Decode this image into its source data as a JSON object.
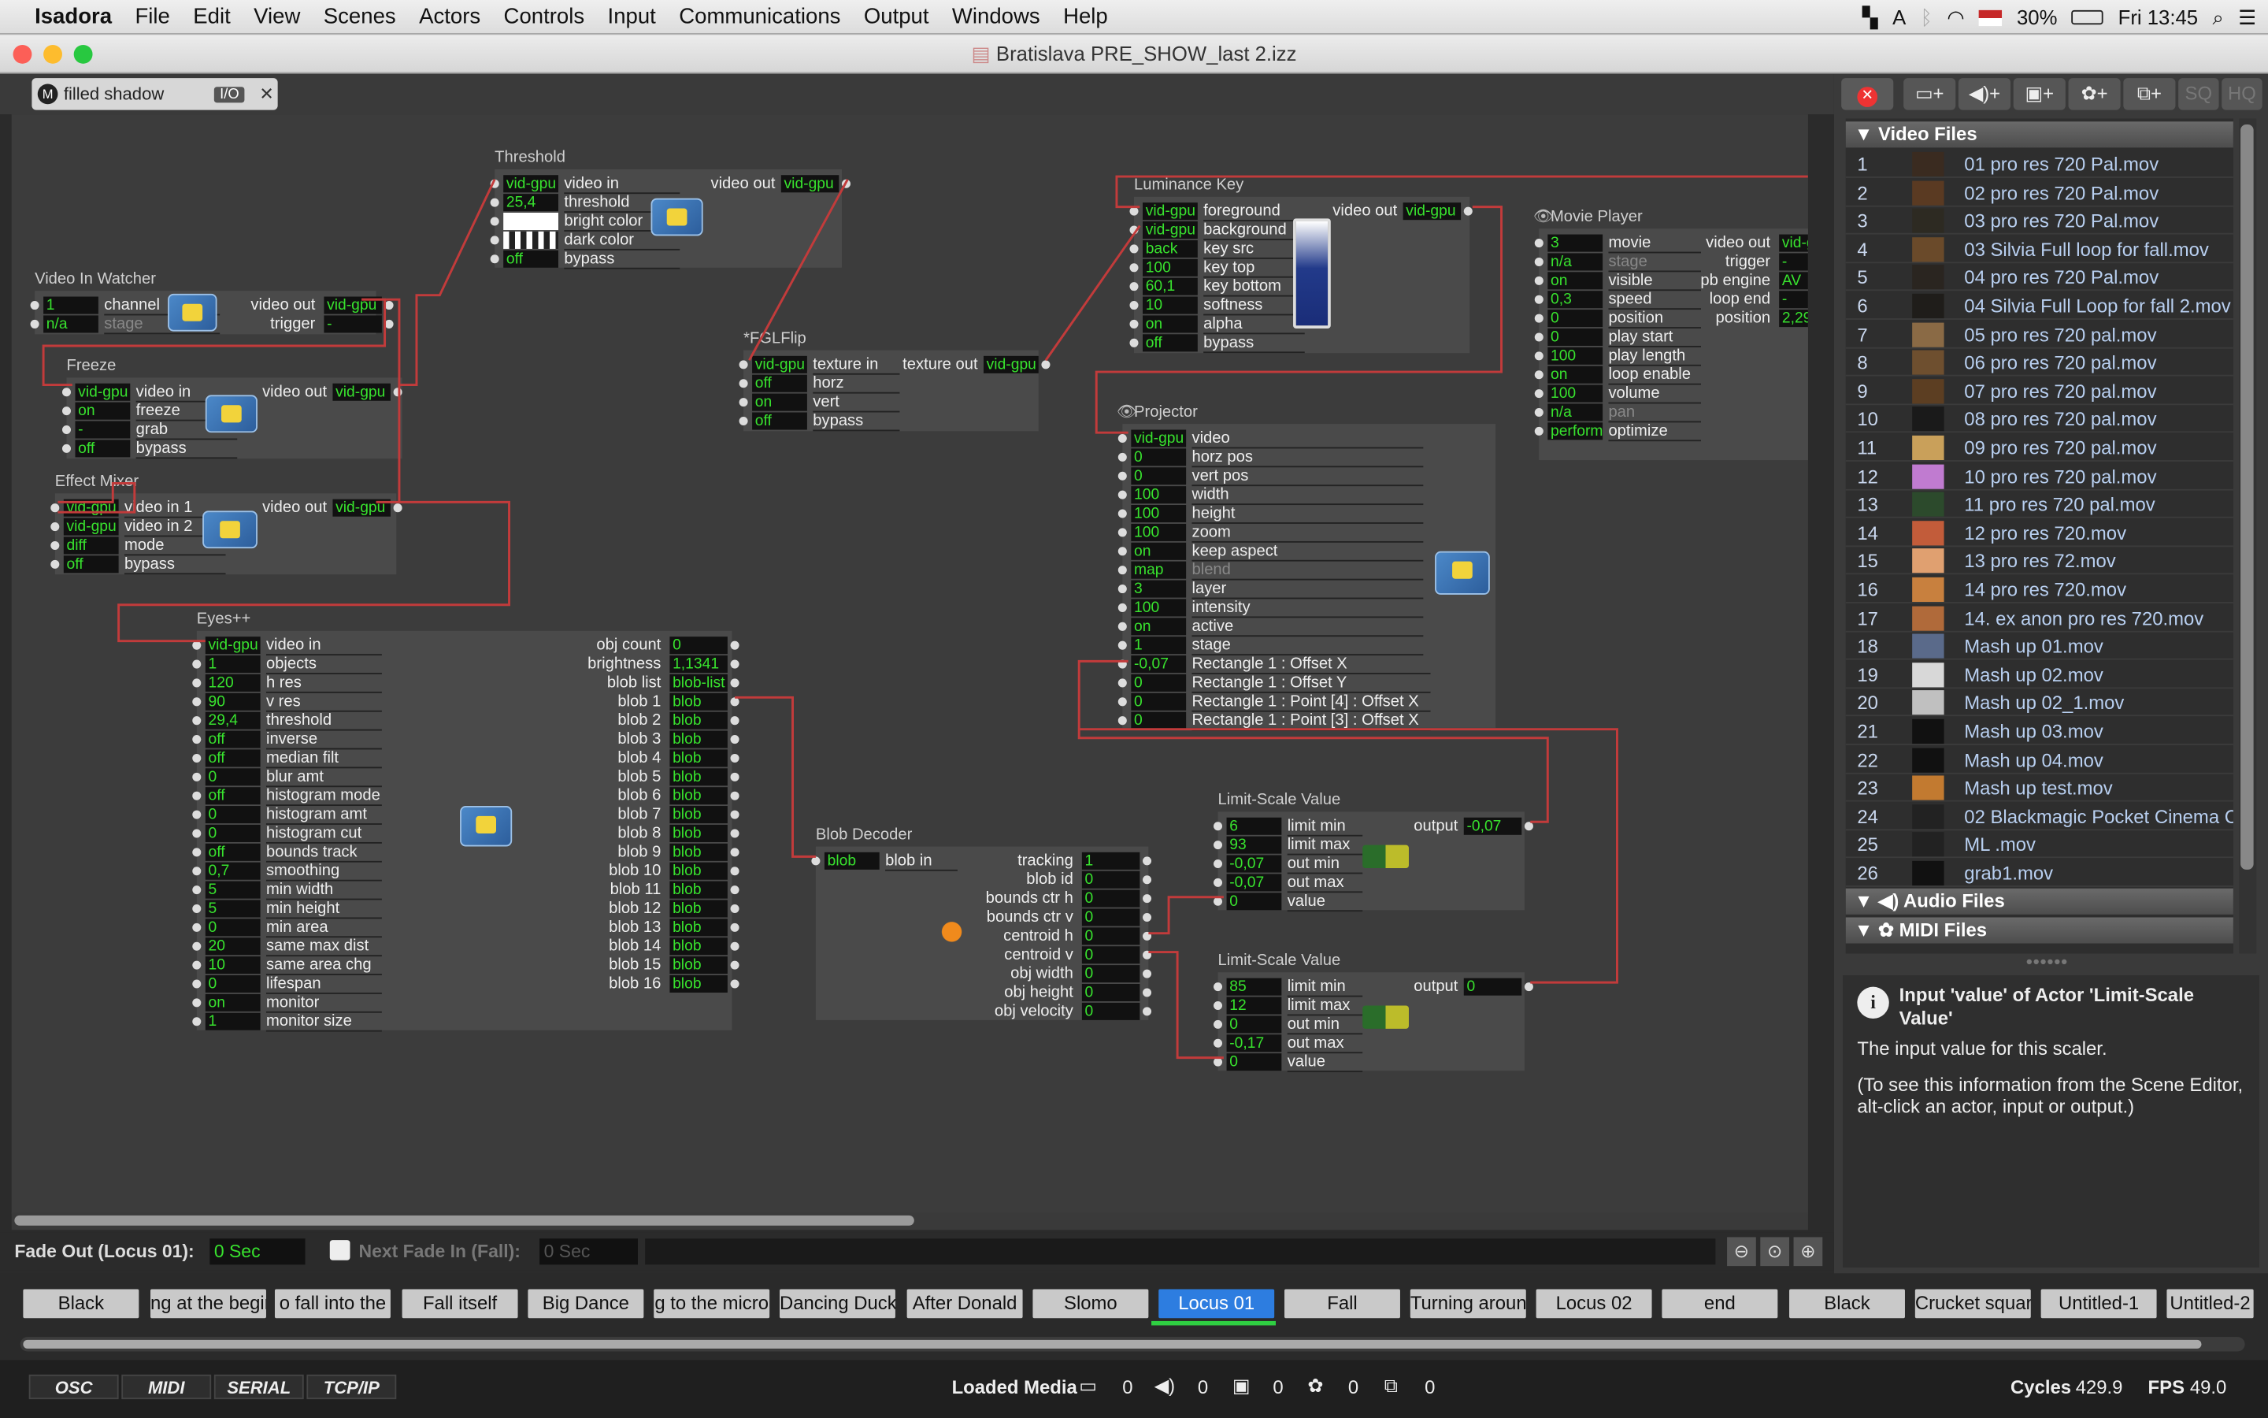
{
  "menubar": {
    "app": "Isadora",
    "items": [
      "File",
      "Edit",
      "View",
      "Scenes",
      "Actors",
      "Controls",
      "Input",
      "Communications",
      "Output",
      "Windows",
      "Help"
    ],
    "battery": "30%",
    "clock": "Fri 13:45"
  },
  "window": {
    "title": "Bratislava PRE_SHOW_last 2.izz"
  },
  "scene_tab": {
    "label": "filled shadow",
    "io": "I/O"
  },
  "actors": {
    "threshold": {
      "title": "Threshold",
      "inputs": [
        [
          "vid-gpu",
          "video in"
        ],
        [
          "25,4",
          "threshold"
        ],
        [
          "",
          "bright color"
        ],
        [
          "",
          "dark color"
        ],
        [
          "off",
          "bypass"
        ]
      ],
      "out_label": "video out",
      "out_value": "vid-gpu"
    },
    "video_in_watcher": {
      "title": "Video In Watcher",
      "inputs": [
        [
          "1",
          "channel"
        ],
        [
          "n/a",
          "stage"
        ]
      ],
      "outs": [
        [
          "video out",
          "vid-gpu"
        ],
        [
          "trigger",
          "-"
        ]
      ]
    },
    "freeze": {
      "title": "Freeze",
      "inputs": [
        [
          "vid-gpu",
          "video in"
        ],
        [
          "on",
          "freeze"
        ],
        [
          "-",
          "grab"
        ],
        [
          "off",
          "bypass"
        ]
      ],
      "out_label": "video out",
      "out_value": "vid-gpu"
    },
    "effect_mixer": {
      "title": "Effect Mixer",
      "inputs": [
        [
          "vid-gpu",
          "video in 1"
        ],
        [
          "vid-gpu",
          "video in 2"
        ],
        [
          "diff",
          "mode"
        ],
        [
          "off",
          "bypass"
        ]
      ],
      "out_label": "video out",
      "out_value": "vid-gpu"
    },
    "fglflip": {
      "title": "*FGLFlip",
      "inputs": [
        [
          "vid-gpu",
          "texture in"
        ],
        [
          "off",
          "horz"
        ],
        [
          "on",
          "vert"
        ],
        [
          "off",
          "bypass"
        ]
      ],
      "out_label": "texture out",
      "out_value": "vid-gpu"
    },
    "luminance_key": {
      "title": "Luminance Key",
      "inputs": [
        [
          "vid-gpu",
          "foreground"
        ],
        [
          "vid-gpu",
          "background"
        ],
        [
          "back",
          "key src"
        ],
        [
          "100",
          "key top"
        ],
        [
          "60,1",
          "key bottom"
        ],
        [
          "10",
          "softness"
        ],
        [
          "on",
          "alpha"
        ],
        [
          "off",
          "bypass"
        ]
      ],
      "out_label": "video out",
      "out_value": "vid-gpu"
    },
    "movie_player": {
      "title": "Movie Player",
      "inputs": [
        [
          "3",
          "movie"
        ],
        [
          "n/a",
          "stage"
        ],
        [
          "on",
          "visible"
        ],
        [
          "0,3",
          "speed"
        ],
        [
          "0",
          "position"
        ],
        [
          "0",
          "play start"
        ],
        [
          "100",
          "play length"
        ],
        [
          "on",
          "loop enable"
        ],
        [
          "100",
          "volume"
        ],
        [
          "n/a",
          "pan"
        ],
        [
          "performa",
          "optimize"
        ]
      ],
      "outs": [
        [
          "video out",
          "vid-g"
        ],
        [
          "trigger",
          "-"
        ],
        [
          "pb engine",
          "AV"
        ],
        [
          "loop end",
          "-"
        ],
        [
          "position",
          "2,29"
        ]
      ]
    },
    "projector": {
      "title": "Projector",
      "inputs": [
        [
          "vid-gpu",
          "video"
        ],
        [
          "0",
          "horz pos"
        ],
        [
          "0",
          "vert pos"
        ],
        [
          "100",
          "width"
        ],
        [
          "100",
          "height"
        ],
        [
          "100",
          "zoom"
        ],
        [
          "on",
          "keep aspect"
        ],
        [
          "map",
          "blend"
        ],
        [
          "3",
          "layer"
        ],
        [
          "100",
          "intensity"
        ],
        [
          "on",
          "active"
        ],
        [
          "1",
          "stage"
        ],
        [
          "-0,07",
          "Rectangle 1 : Offset X"
        ],
        [
          "0",
          "Rectangle 1 : Offset Y"
        ],
        [
          "0",
          "Rectangle 1 : Point [4] : Offset X"
        ],
        [
          "0",
          "Rectangle 1 : Point [3] : Offset X"
        ]
      ]
    },
    "eyes": {
      "title": "Eyes++",
      "inputs": [
        [
          "vid-gpu",
          "video in"
        ],
        [
          "1",
          "objects"
        ],
        [
          "120",
          "h res"
        ],
        [
          "90",
          "v res"
        ],
        [
          "29,4",
          "threshold"
        ],
        [
          "off",
          "inverse"
        ],
        [
          "off",
          "median filt"
        ],
        [
          "0",
          "blur amt"
        ],
        [
          "off",
          "histogram mode"
        ],
        [
          "0",
          "histogram amt"
        ],
        [
          "0",
          "histogram cut"
        ],
        [
          "off",
          "bounds track"
        ],
        [
          "0,7",
          "smoothing"
        ],
        [
          "5",
          "min width"
        ],
        [
          "5",
          "min height"
        ],
        [
          "0",
          "min area"
        ],
        [
          "20",
          "same max dist"
        ],
        [
          "10",
          "same area chg"
        ],
        [
          "0",
          "lifespan"
        ],
        [
          "on",
          "monitor"
        ],
        [
          "1",
          "monitor size"
        ]
      ],
      "outs": [
        [
          "obj count",
          "0"
        ],
        [
          "brightness",
          "1,1341"
        ],
        [
          "blob list",
          "blob-list"
        ],
        [
          "blob 1",
          "blob"
        ],
        [
          "blob 2",
          "blob"
        ],
        [
          "blob 3",
          "blob"
        ],
        [
          "blob 4",
          "blob"
        ],
        [
          "blob 5",
          "blob"
        ],
        [
          "blob 6",
          "blob"
        ],
        [
          "blob 7",
          "blob"
        ],
        [
          "blob 8",
          "blob"
        ],
        [
          "blob 9",
          "blob"
        ],
        [
          "blob 10",
          "blob"
        ],
        [
          "blob 11",
          "blob"
        ],
        [
          "blob 12",
          "blob"
        ],
        [
          "blob 13",
          "blob"
        ],
        [
          "blob 14",
          "blob"
        ],
        [
          "blob 15",
          "blob"
        ],
        [
          "blob 16",
          "blob"
        ]
      ]
    },
    "blob_decoder": {
      "title": "Blob Decoder",
      "inputs": [
        [
          "blob",
          "blob in"
        ]
      ],
      "outs": [
        [
          "tracking",
          "1"
        ],
        [
          "blob id",
          "0"
        ],
        [
          "bounds ctr h",
          "0"
        ],
        [
          "bounds ctr v",
          "0"
        ],
        [
          "centroid h",
          "0"
        ],
        [
          "centroid v",
          "0"
        ],
        [
          "obj width",
          "0"
        ],
        [
          "obj height",
          "0"
        ],
        [
          "obj velocity",
          "0"
        ]
      ]
    },
    "lsv1": {
      "title": "Limit-Scale Value",
      "inputs": [
        [
          "6",
          "limit min"
        ],
        [
          "93",
          "limit max"
        ],
        [
          "-0,07",
          "out min"
        ],
        [
          "-0,07",
          "out max"
        ],
        [
          "0",
          "value"
        ]
      ],
      "out_label": "output",
      "out_value": "-0,07"
    },
    "lsv2": {
      "title": "Limit-Scale Value",
      "inputs": [
        [
          "85",
          "limit min"
        ],
        [
          "12",
          "limit max"
        ],
        [
          "0",
          "out min"
        ],
        [
          "-0,17",
          "out max"
        ],
        [
          "0",
          "value"
        ]
      ],
      "out_label": "output",
      "out_value": "0"
    }
  },
  "fade": {
    "out_label": "Fade Out (Locus 01):",
    "out_value": "0 Sec",
    "next_label": "Next Fade In (Fall):",
    "next_value": "0 Sec"
  },
  "toolbar": {
    "sq": "SQ",
    "hq": "HQ"
  },
  "media": {
    "video_header": "Video Files",
    "videos": [
      [
        "1",
        "01 pro res 720 Pal.mov"
      ],
      [
        "2",
        "02 pro res 720 Pal.mov"
      ],
      [
        "3",
        "03 pro res 720 Pal.mov"
      ],
      [
        "4",
        "03 Silvia Full loop for fall.mov"
      ],
      [
        "5",
        "04 pro res 720 Pal.mov"
      ],
      [
        "6",
        "04 Silvia Full Loop for fall 2.mov"
      ],
      [
        "7",
        "05 pro res 720 pal.mov"
      ],
      [
        "8",
        "06 pro res 720 pal.mov"
      ],
      [
        "9",
        "07 pro res 720 pal.mov"
      ],
      [
        "10",
        "08 pro res 720 pal.mov"
      ],
      [
        "11",
        "09 pro res 720 pal.mov"
      ],
      [
        "12",
        "10 pro res 720 pal.mov"
      ],
      [
        "13",
        "11 pro res 720 pal.mov"
      ],
      [
        "14",
        "12 pro res 720.mov"
      ],
      [
        "15",
        "13 pro res 72.mov"
      ],
      [
        "16",
        "14 pro res 720.mov"
      ],
      [
        "17",
        "14. ex anon pro res 720.mov"
      ],
      [
        "18",
        "Mash up 01.mov"
      ],
      [
        "19",
        "Mash up 02.mov"
      ],
      [
        "20",
        "Mash up 02_1.mov"
      ],
      [
        "21",
        "Mash up 03.mov"
      ],
      [
        "22",
        "Mash up 04.mov"
      ],
      [
        "23",
        "Mash up test.mov"
      ],
      [
        "24",
        "02 Blackmagic Pocket Cinema C"
      ],
      [
        "25",
        "ML .mov"
      ],
      [
        "26",
        "grab1.mov"
      ]
    ],
    "audio_header": "Audio Files",
    "midi_header": "MIDI Files"
  },
  "info": {
    "title": "Input 'value' of Actor 'Limit-Scale Value'",
    "body1": "The input value for this scaler.",
    "body2": "(To see this information from the Scene Editor, alt-click an actor, input or output.)"
  },
  "scenes": [
    "Black",
    "ng at the begin",
    "o fall into the",
    "Fall itself",
    "Big Dance",
    "g to the micro",
    "Dancing Duck",
    "After Donald",
    "Slomo",
    "Locus 01",
    "Fall",
    "Turning around",
    "Locus 02",
    "end",
    "Black",
    "Crucket square",
    "Untitled-1",
    "Untitled-2"
  ],
  "active_scene": "Locus 01",
  "status": {
    "buttons": [
      "OSC",
      "MIDI",
      "SERIAL",
      "TCP/IP"
    ],
    "loaded_label": "Loaded Media",
    "counts": [
      "0",
      "0",
      "0",
      "0",
      "0"
    ],
    "cycles_label": "Cycles",
    "cycles": "429.9",
    "fps_label": "FPS",
    "fps": "49.0"
  },
  "colors": {
    "wire": "#c23b3b",
    "value_green": "#38e22e",
    "active_scene": "#2d7de0"
  }
}
